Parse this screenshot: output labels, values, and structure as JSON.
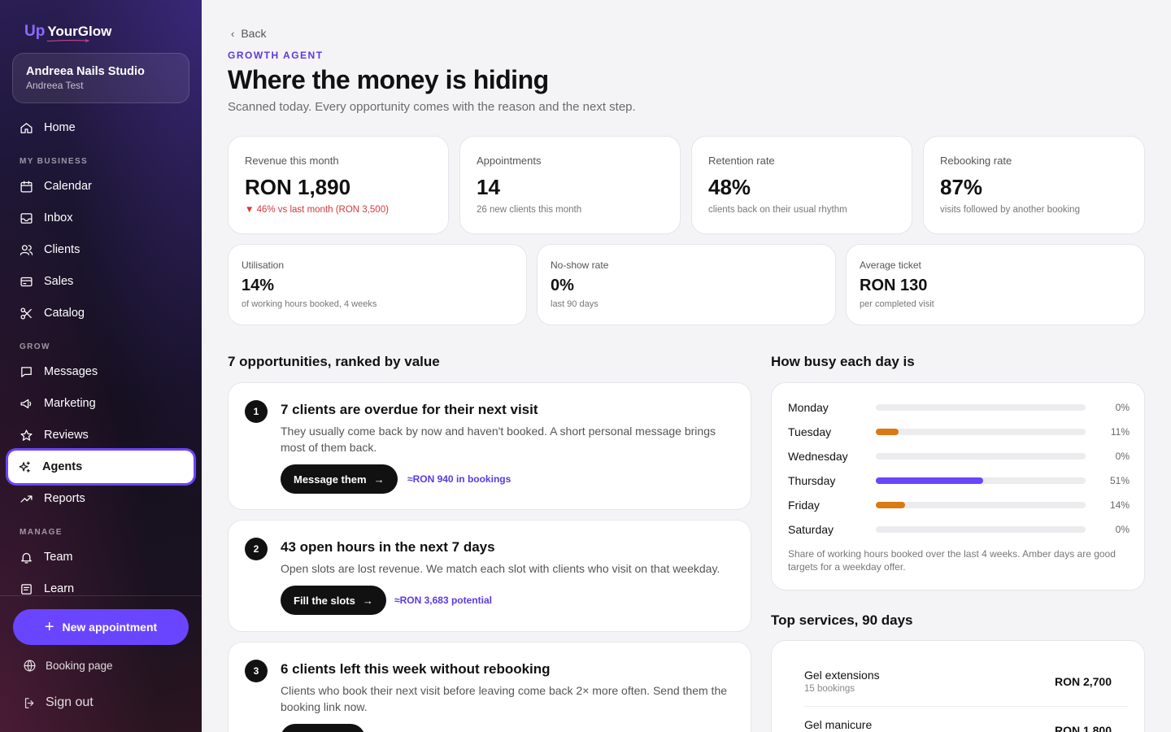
{
  "brand": {
    "up": "Up",
    "name": "YourGlow",
    "accent": "#6a45ff"
  },
  "studio": {
    "name": "Andreea Nails Studio",
    "user": "Andreea Test"
  },
  "nav": {
    "home": "Home",
    "my_business_label": "MY BUSINESS",
    "calendar": "Calendar",
    "inbox": "Inbox",
    "clients": "Clients",
    "sales": "Sales",
    "catalog": "Catalog",
    "grow_label": "GROW",
    "messages": "Messages",
    "marketing": "Marketing",
    "reviews": "Reviews",
    "agents": "Agents",
    "reports": "Reports",
    "manage_label": "MANAGE",
    "team": "Team",
    "learn": "Learn",
    "new_appointment": "New appointment",
    "booking_page": "Booking page",
    "sign_out": "Sign out"
  },
  "header": {
    "back": "Back",
    "eyebrow": "GROWTH AGENT",
    "title": "Where the money is hiding",
    "subtitle": "Scanned today. Every opportunity comes with the reason and the next step."
  },
  "kpis": [
    {
      "label": "Revenue this month",
      "value": "RON 1,890",
      "note": "▼ 46% vs last month (RON 3,500)"
    },
    {
      "label": "Appointments",
      "value": "14",
      "note": "26 new clients this month"
    },
    {
      "label": "Retention rate",
      "value": "48%",
      "note": "clients back on their usual rhythm"
    },
    {
      "label": "Rebooking rate",
      "value": "87%",
      "note": "visits followed by another booking"
    }
  ],
  "kpis2": [
    {
      "label": "Utilisation",
      "value": "14%",
      "note": "of working hours booked, 4 weeks"
    },
    {
      "label": "No-show rate",
      "value": "0%",
      "note": "last 90 days"
    },
    {
      "label": "Average ticket",
      "value": "RON 130",
      "note": "per completed visit"
    }
  ],
  "opportunities": {
    "heading": "7 opportunities, ranked by value",
    "items": [
      {
        "num": "1",
        "title": "7 clients are overdue for their next visit",
        "desc": "They usually come back by now and haven't booked. A short personal message brings most of them back.",
        "button": "Message them",
        "value": "≈RON 940 in bookings"
      },
      {
        "num": "2",
        "title": "43 open hours in the next 7 days",
        "desc": "Open slots are lost revenue. We match each slot with clients who visit on that weekday.",
        "button": "Fill the slots",
        "value": "≈RON 3,683 potential"
      },
      {
        "num": "3",
        "title": "6 clients left this week without rebooking",
        "desc": "Clients who book their next visit before leaving come back 2× more often. Send them the booking link now.",
        "button": "",
        "value": ""
      }
    ]
  },
  "busy": {
    "heading": "How busy each day is",
    "days": [
      {
        "name": "Monday",
        "pct_label": "0%",
        "value": 0,
        "color": "#d9d9de"
      },
      {
        "name": "Tuesday",
        "pct_label": "11%",
        "value": 11,
        "color": "#d97a12"
      },
      {
        "name": "Wednesday",
        "pct_label": "0%",
        "value": 0,
        "color": "#d9d9de"
      },
      {
        "name": "Thursday",
        "pct_label": "51%",
        "value": 51,
        "color": "#6a45ff"
      },
      {
        "name": "Friday",
        "pct_label": "14%",
        "value": 14,
        "color": "#d97a12"
      },
      {
        "name": "Saturday",
        "pct_label": "0%",
        "value": 0,
        "color": "#d9d9de"
      }
    ],
    "note": "Share of working hours booked over the last 4 weeks. Amber days are good targets for a weekday offer."
  },
  "services": {
    "heading": "Top services, 90 days",
    "items": [
      {
        "name": "Gel extensions",
        "count": "15 bookings",
        "value": "RON 2,700"
      },
      {
        "name": "Gel manicure",
        "count": "",
        "value": "RON 1,800"
      }
    ]
  }
}
